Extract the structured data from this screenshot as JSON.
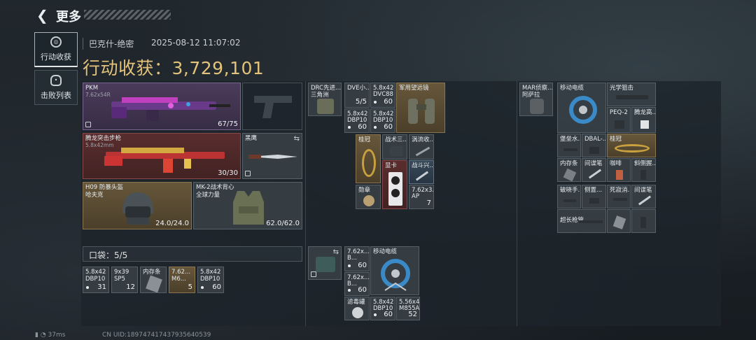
{
  "header": {
    "title": "更多"
  },
  "tabs": [
    {
      "label": "行动收获",
      "active": true,
      "icon": "target-icon"
    },
    {
      "label": "击败列表",
      "active": false,
      "icon": "skull-icon"
    }
  ],
  "info": {
    "map": "巴克什-绝密",
    "timestamp": "2025-08-12 11:07:02",
    "haul_label": "行动收获：",
    "haul_value": "3,729,101"
  },
  "equipment": {
    "primary1": {
      "name": "PKM",
      "caliber": "7.62x54R",
      "ammo": "67/75"
    },
    "primary2": {
      "name": "腾龙突击步枪",
      "caliber": "5.8x42mm",
      "ammo": "30/30"
    },
    "melee": {
      "name": "黑鹰"
    },
    "helmet": {
      "name": "H09 防暴头盔",
      "sub": "哈夫克",
      "durability": "24.0/24.0"
    },
    "vest": {
      "name": "MK-2战术背心",
      "sub": "全球力量",
      "durability": "62.0/62.0"
    }
  },
  "pocket": {
    "label": "口袋：5/5",
    "items": [
      {
        "name": "5.8x42",
        "sub": "DBP10",
        "count": "31"
      },
      {
        "name": "9x39",
        "sub": "SP5",
        "count": "12"
      },
      {
        "name": "内存条",
        "sub": "",
        "count": ""
      },
      {
        "name": "7.62...",
        "sub": "M6...",
        "count": "5"
      },
      {
        "name": "5.8x42",
        "sub": "DBP10",
        "count": "60"
      }
    ]
  },
  "chest_rig": {
    "name": "DRC先进...",
    "sub": "三角洲",
    "items": [
      {
        "name": "DVE小...",
        "count": "5/5"
      },
      {
        "name": "5.8x42",
        "sub": "DVC88",
        "count": "60"
      },
      {
        "name": "军用望远镜",
        "count": ""
      },
      {
        "name": "5.8x42",
        "sub": "DBP10",
        "count": "60"
      },
      {
        "name": "5.8x42",
        "sub": "DBP10",
        "count": "60"
      }
    ]
  },
  "middle_items": [
    {
      "name": "桂冠",
      "count": ""
    },
    {
      "name": "战术三...",
      "count": ""
    },
    {
      "name": "涡流收...",
      "count": ""
    },
    {
      "name": "显卡",
      "count": ""
    },
    {
      "name": "战斗兴...",
      "count": ""
    },
    {
      "name": "勋章",
      "count": ""
    },
    {
      "name": "7.62x3...",
      "sub": "AP",
      "count": "7"
    }
  ],
  "bag": {
    "items": [
      {
        "name": "7.62x...",
        "sub": "B...",
        "count": "60"
      },
      {
        "name": "移动电缆",
        "count": ""
      },
      {
        "name": "7.62x...",
        "sub": "B...",
        "count": "60"
      },
      {
        "name": "滤毒罐",
        "count": ""
      },
      {
        "name": "5.8x42",
        "sub": "DBP10",
        "count": "60"
      },
      {
        "name": "5.56x4...",
        "sub": "M855A...",
        "count": "52"
      }
    ]
  },
  "backpack": {
    "name": "MAR侦察...",
    "sub": "阿萨拉",
    "items": [
      {
        "name": "移动电缆"
      },
      {
        "name": "光学狙击"
      },
      {
        "name": "PEQ-2"
      },
      {
        "name": "腾龙高..."
      },
      {
        "name": "堡垒水..."
      },
      {
        "name": "DBAL-..."
      },
      {
        "name": "桂冠"
      },
      {
        "name": "内存条"
      },
      {
        "name": "间谍笔"
      },
      {
        "name": "咖啡"
      },
      {
        "name": "斜侧握..."
      },
      {
        "name": "破晓手..."
      },
      {
        "name": "侧置..."
      },
      {
        "name": "死寂消..."
      },
      {
        "name": "间谍笔"
      },
      {
        "name": "超长枪管"
      }
    ]
  },
  "status": {
    "ping": "37ms",
    "uid": "CN UID:189747417437935640539"
  }
}
